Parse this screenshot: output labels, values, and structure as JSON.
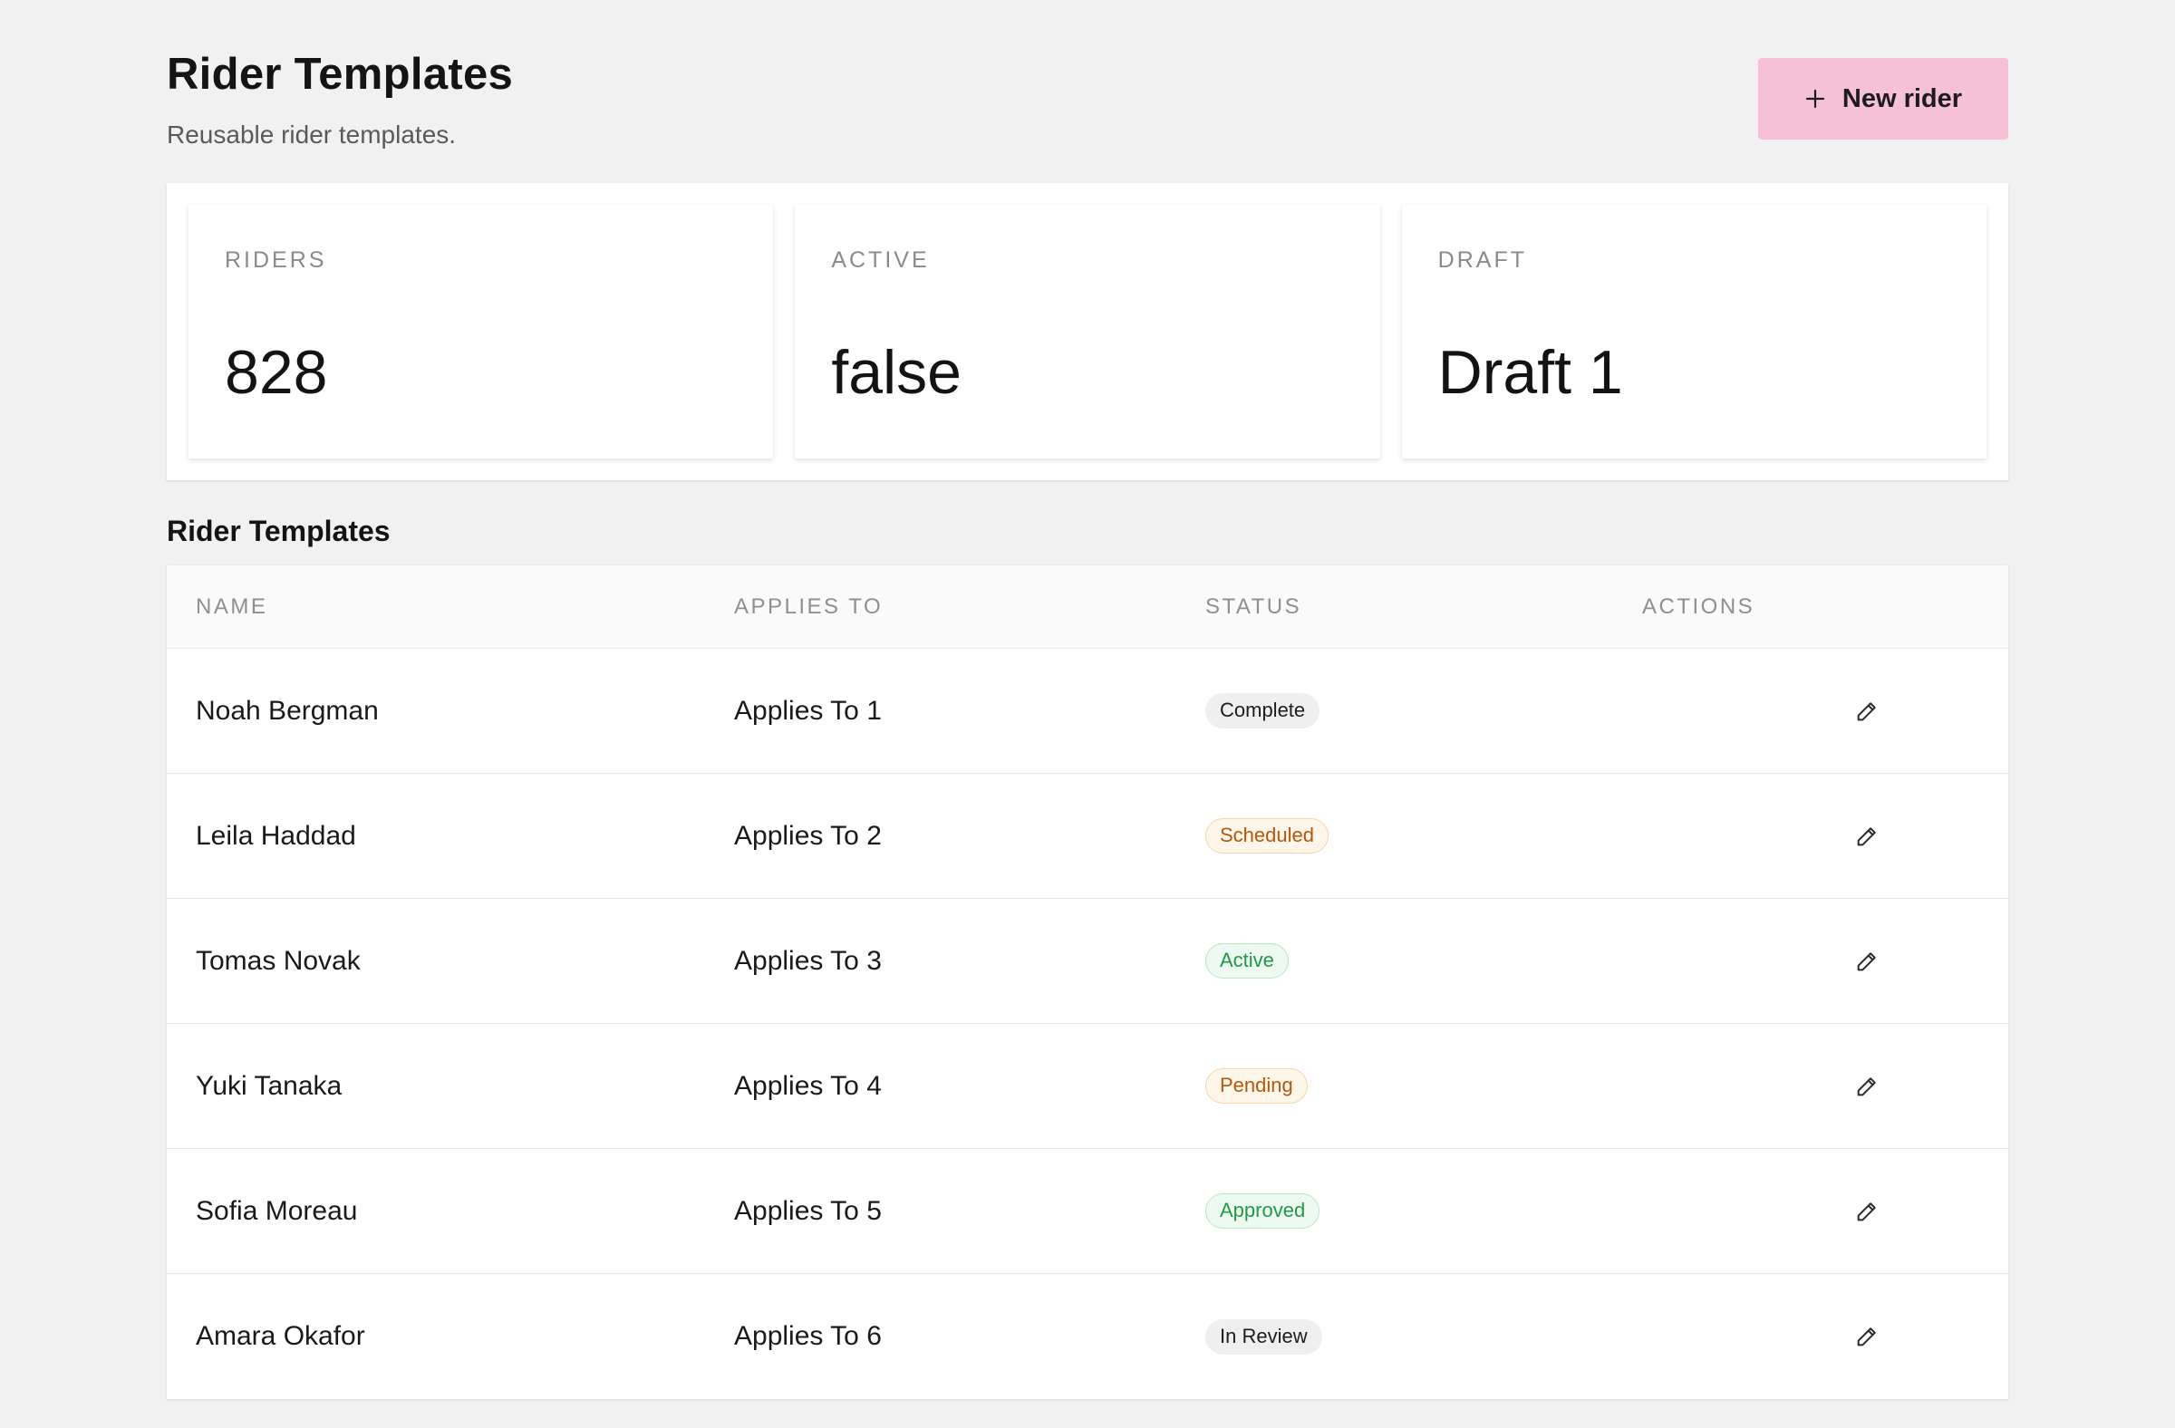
{
  "header": {
    "title": "Rider Templates",
    "subtitle": "Reusable rider templates.",
    "new_button_label": "New rider",
    "new_button_icon": "plus-icon"
  },
  "stats": [
    {
      "label": "RIDERS",
      "value": "828"
    },
    {
      "label": "ACTIVE",
      "value": "false"
    },
    {
      "label": "DRAFT",
      "value": "Draft 1"
    }
  ],
  "table": {
    "section_title": "Rider Templates",
    "columns": [
      "NAME",
      "APPLIES TO",
      "STATUS",
      "ACTIONS"
    ],
    "rows": [
      {
        "name": "Noah Bergman",
        "applies_to": "Applies To 1",
        "status": "Complete",
        "status_tone": "neutral"
      },
      {
        "name": "Leila Haddad",
        "applies_to": "Applies To 2",
        "status": "Scheduled",
        "status_tone": "amber"
      },
      {
        "name": "Tomas Novak",
        "applies_to": "Applies To 3",
        "status": "Active",
        "status_tone": "green"
      },
      {
        "name": "Yuki Tanaka",
        "applies_to": "Applies To 4",
        "status": "Pending",
        "status_tone": "amber"
      },
      {
        "name": "Sofia Moreau",
        "applies_to": "Applies To 5",
        "status": "Approved",
        "status_tone": "green"
      },
      {
        "name": "Amara Okafor",
        "applies_to": "Applies To 6",
        "status": "In Review",
        "status_tone": "neutral"
      }
    ],
    "row_action_icon": "pencil-icon"
  },
  "colors": {
    "background": "#f1f1f1",
    "accent_button": "#f6c1d7",
    "status_neutral": "#efefef",
    "status_amber": "#b5560b",
    "status_green": "#1e9a48"
  }
}
